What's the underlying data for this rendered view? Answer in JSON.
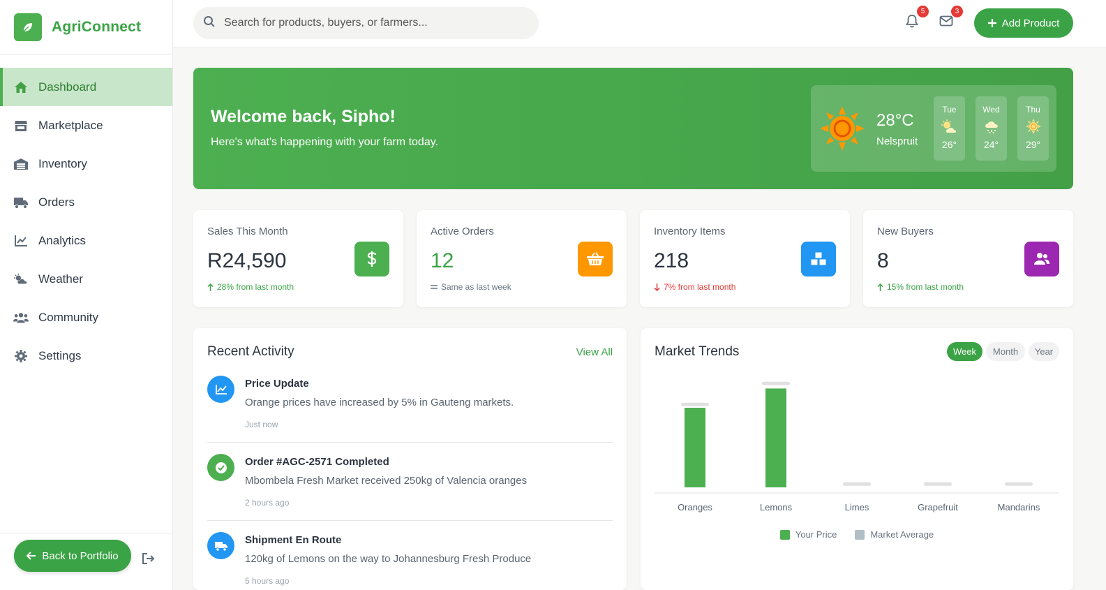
{
  "app": {
    "name": "AgriConnect"
  },
  "sidebar": {
    "items": [
      {
        "label": "Dashboard",
        "icon": "home-icon",
        "active": true
      },
      {
        "label": "Marketplace",
        "icon": "store-icon"
      },
      {
        "label": "Inventory",
        "icon": "warehouse-icon"
      },
      {
        "label": "Orders",
        "icon": "truck-icon"
      },
      {
        "label": "Analytics",
        "icon": "chart-line-icon"
      },
      {
        "label": "Weather",
        "icon": "cloud-sun-icon"
      },
      {
        "label": "Community",
        "icon": "users-icon"
      },
      {
        "label": "Settings",
        "icon": "gear-icon"
      }
    ],
    "back_label": "Back to Portfolio"
  },
  "topbar": {
    "search_placeholder": "Search for products, buyers, or farmers...",
    "notifications_count": "5",
    "messages_count": "3",
    "add_label": "Add Product"
  },
  "hero": {
    "title": "Welcome back, Sipho!",
    "subtitle": "Here's what's happening with your farm today.",
    "weather": {
      "temp": "28°C",
      "city": "Nelspruit",
      "forecast": [
        {
          "day": "Tue",
          "temp": "26°",
          "icon": "partly-sunny-icon"
        },
        {
          "day": "Wed",
          "temp": "24°",
          "icon": "rain-icon"
        },
        {
          "day": "Thu",
          "temp": "29°",
          "icon": "sun-icon"
        }
      ]
    }
  },
  "stats": [
    {
      "label": "Sales This Month",
      "value": "R24,590",
      "trend": "28% from last month",
      "trend_dir": "up",
      "color": "#4caf50",
      "icon": "dollar-icon"
    },
    {
      "label": "Active Orders",
      "value": "12",
      "trend": "Same as last week",
      "trend_dir": "flat",
      "color": "#ff9800",
      "icon": "basket-icon"
    },
    {
      "label": "Inventory Items",
      "value": "218",
      "trend": "7% from last month",
      "trend_dir": "down",
      "color": "#2196f3",
      "icon": "boxes-icon"
    },
    {
      "label": "New Buyers",
      "value": "8",
      "trend": "15% from last month",
      "trend_dir": "up",
      "color": "#9c27b0",
      "icon": "users-icon"
    }
  ],
  "activity": {
    "title": "Recent Activity",
    "view_all": "View All",
    "items": [
      {
        "title": "Price Update",
        "desc": "Orange prices have increased by 5% in Gauteng markets.",
        "time": "Just now",
        "icon": "chart-line-icon",
        "color": "#2196f3"
      },
      {
        "title": "Order #AGC-2571 Completed",
        "desc": "Mbombela Fresh Market received 250kg of Valencia oranges",
        "time": "2 hours ago",
        "icon": "check-circle-icon",
        "color": "#4caf50"
      },
      {
        "title": "Shipment En Route",
        "desc": "120kg of Lemons on the way to Johannesburg Fresh Produce",
        "time": "5 hours ago",
        "icon": "truck-icon",
        "color": "#2196f3"
      }
    ]
  },
  "trends": {
    "title": "Market Trends",
    "tabs": [
      "Week",
      "Month",
      "Year"
    ],
    "active_tab": "Week"
  },
  "chart_data": {
    "type": "bar",
    "categories": [
      "Oranges",
      "Lemons",
      "Limes",
      "Grapefruit",
      "Mandarins"
    ],
    "series": [
      {
        "name": "Your Price",
        "values": [
          95,
          118,
          0,
          0,
          0
        ],
        "color": "#4caf50"
      },
      {
        "name": "Market Average",
        "values": [
          101,
          126,
          6,
          6,
          6
        ],
        "color": "#e0e0e0"
      }
    ],
    "legend": [
      "Your Price",
      "Market Average"
    ],
    "legend_colors": [
      "#4caf50",
      "#b0bec5"
    ],
    "ylim": [
      0,
      140
    ]
  }
}
